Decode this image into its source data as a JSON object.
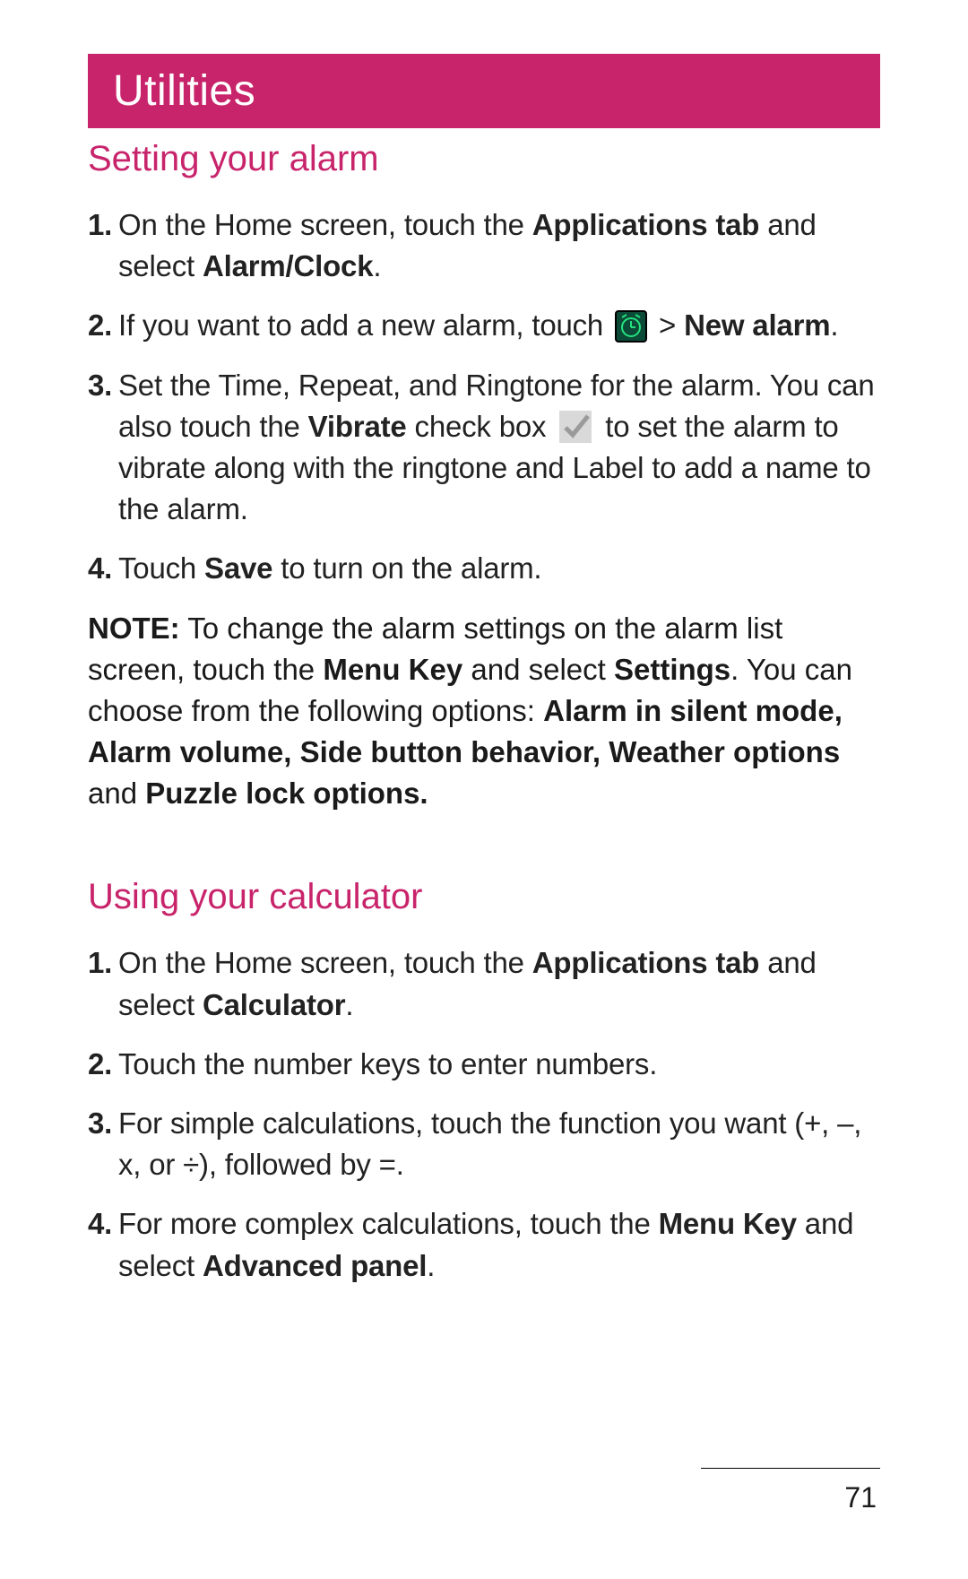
{
  "chapter": {
    "title": "Utilities"
  },
  "section1": {
    "title": "Setting your alarm",
    "items": [
      {
        "n": "1.",
        "parts": [
          {
            "t": "On the Home screen, touch the "
          },
          {
            "t": "Applications tab",
            "b": true
          },
          {
            "t": " and select "
          },
          {
            "t": "Alarm/Clock",
            "b": true
          },
          {
            "t": "."
          }
        ]
      },
      {
        "n": "2.",
        "parts": [
          {
            "t": "If you want to add a new alarm, touch "
          },
          {
            "icon": "alarm"
          },
          {
            "t": " > "
          },
          {
            "t": "New alarm",
            "b": true
          },
          {
            "t": "."
          }
        ]
      },
      {
        "n": "3.",
        "parts": [
          {
            "t": "Set the Time, Repeat, and Ringtone for the alarm. You can also touch the "
          },
          {
            "t": "Vibrate",
            "b": true
          },
          {
            "t": " check box "
          },
          {
            "icon": "check"
          },
          {
            "t": " to set the alarm to vibrate along with the ringtone and Label to add a name to the alarm."
          }
        ]
      },
      {
        "n": "4.",
        "parts": [
          {
            "t": "Touch "
          },
          {
            "t": "Save",
            "b": true
          },
          {
            "t": " to turn on the alarm."
          }
        ]
      }
    ],
    "note": [
      {
        "t": "NOTE:",
        "b": true
      },
      {
        "t": " To change the alarm settings on the alarm list screen, touch the "
      },
      {
        "t": "Menu Key",
        "b": true
      },
      {
        "t": " and select "
      },
      {
        "t": "Settings",
        "b": true
      },
      {
        "t": ". You can choose from the following options: "
      },
      {
        "t": "Alarm in silent mode, Alarm volume, Side button behavior, Weather options",
        "b": true
      },
      {
        "t": " and "
      },
      {
        "t": "Puzzle lock options.",
        "b": true
      }
    ]
  },
  "section2": {
    "title": "Using your calculator",
    "items": [
      {
        "n": "1.",
        "parts": [
          {
            "t": "On the Home screen, touch the "
          },
          {
            "t": "Applications tab",
            "b": true
          },
          {
            "t": " and select "
          },
          {
            "t": "Calculator",
            "b": true
          },
          {
            "t": "."
          }
        ]
      },
      {
        "n": "2.",
        "parts": [
          {
            "t": "Touch the number keys to enter numbers."
          }
        ]
      },
      {
        "n": "3.",
        "parts": [
          {
            "t": "For simple calculations, touch the function you want (+, –, x, or ÷), followed by =."
          }
        ]
      },
      {
        "n": "4.",
        "parts": [
          {
            "t": "For more complex calculations, touch the "
          },
          {
            "t": "Menu Key",
            "b": true
          },
          {
            "t": " and select "
          },
          {
            "t": "Advanced panel",
            "b": true
          },
          {
            "t": "."
          }
        ]
      }
    ]
  },
  "page_number": "71"
}
